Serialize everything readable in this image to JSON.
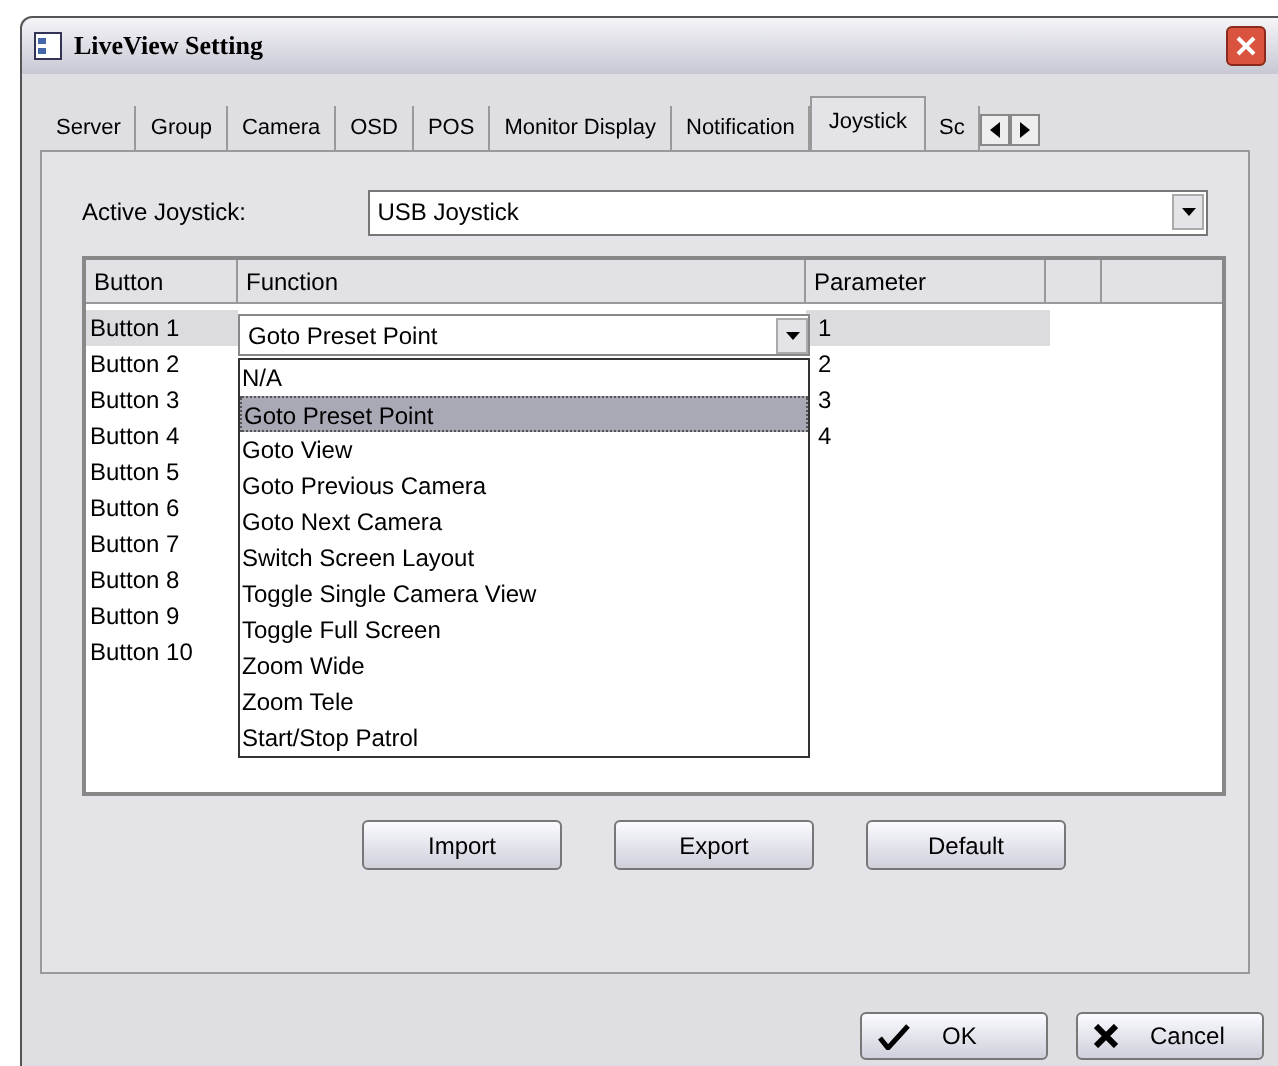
{
  "window": {
    "title": "LiveView Setting"
  },
  "tabs": [
    {
      "label": "Server",
      "selected": false
    },
    {
      "label": "Group",
      "selected": false
    },
    {
      "label": "Camera",
      "selected": false
    },
    {
      "label": "OSD",
      "selected": false
    },
    {
      "label": "POS",
      "selected": false
    },
    {
      "label": "Monitor Display",
      "selected": false
    },
    {
      "label": "Notification",
      "selected": false
    },
    {
      "label": "Joystick",
      "selected": true
    },
    {
      "label": "Sc",
      "selected": false
    }
  ],
  "active_joystick": {
    "label": "Active Joystick:",
    "value": "USB Joystick"
  },
  "table": {
    "columns": [
      "Button",
      "Function",
      "Parameter"
    ],
    "rows": [
      {
        "button": "Button 1",
        "function": "Goto Preset Point",
        "parameter": "1",
        "selected": true
      },
      {
        "button": "Button 2",
        "parameter": "2",
        "selected": false
      },
      {
        "button": "Button 3",
        "parameter": "3",
        "selected": false
      },
      {
        "button": "Button 4",
        "parameter": "4",
        "selected": false
      },
      {
        "button": "Button 5",
        "selected": false
      },
      {
        "button": "Button 6",
        "selected": false
      },
      {
        "button": "Button 7",
        "selected": false
      },
      {
        "button": "Button 8",
        "selected": false
      },
      {
        "button": "Button 9",
        "selected": false
      },
      {
        "button": "Button 10",
        "selected": false
      }
    ]
  },
  "function_options": [
    {
      "label": "N/A",
      "selected": false
    },
    {
      "label": "Goto Preset Point",
      "selected": true
    },
    {
      "label": "Goto View",
      "selected": false
    },
    {
      "label": "Goto Previous Camera",
      "selected": false
    },
    {
      "label": "Goto Next Camera",
      "selected": false
    },
    {
      "label": "Switch Screen Layout",
      "selected": false
    },
    {
      "label": "Toggle Single Camera View",
      "selected": false
    },
    {
      "label": "Toggle Full Screen",
      "selected": false
    },
    {
      "label": "Zoom Wide",
      "selected": false
    },
    {
      "label": "Zoom Tele",
      "selected": false
    },
    {
      "label": "Start/Stop Patrol",
      "selected": false
    }
  ],
  "panel_buttons": [
    "Import",
    "Export",
    "Default"
  ],
  "dialog_buttons": [
    {
      "label": "OK",
      "kind": "ok"
    },
    {
      "label": "Cancel",
      "kind": "cancel"
    }
  ]
}
